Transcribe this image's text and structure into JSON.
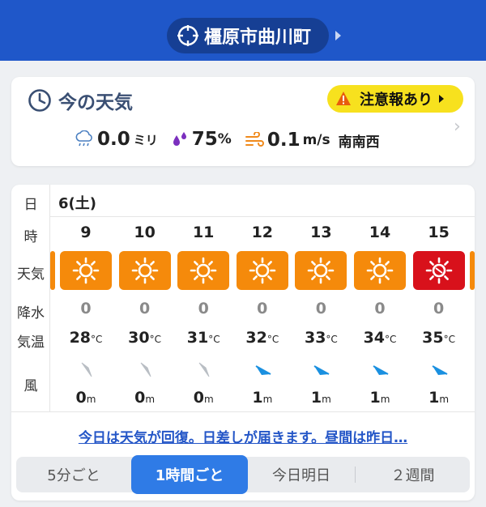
{
  "header": {
    "location": "橿原市曲川町",
    "icon": "location-target-icon"
  },
  "current": {
    "title": "今の天気",
    "warning_label": "注意報あり",
    "precip_value": "0.0",
    "precip_unit": "ミリ",
    "humidity_value": "75",
    "humidity_unit": "%",
    "wind_value": "0.1",
    "wind_unit": "m/s",
    "wind_dir": "南南西"
  },
  "forecast": {
    "labels": {
      "date": "日",
      "hour": "時",
      "weather": "天気",
      "precip": "降水",
      "temp": "気温",
      "wind": "風"
    },
    "date": "6(土)",
    "hours": [
      {
        "hour": "9",
        "weather": "sunny",
        "color": "#f58a0b",
        "precip": "0",
        "temp": "28",
        "wind": "0",
        "wind_color": "#b9bec4",
        "wind_dir": "calm"
      },
      {
        "hour": "10",
        "weather": "sunny",
        "color": "#f58a0b",
        "precip": "0",
        "temp": "30",
        "wind": "0",
        "wind_color": "#b9bec4",
        "wind_dir": "calm"
      },
      {
        "hour": "11",
        "weather": "sunny",
        "color": "#f58a0b",
        "precip": "0",
        "temp": "31",
        "wind": "0",
        "wind_color": "#b9bec4",
        "wind_dir": "calm"
      },
      {
        "hour": "12",
        "weather": "sunny",
        "color": "#f58a0b",
        "precip": "0",
        "temp": "32",
        "wind": "1",
        "wind_color": "#1a90e0",
        "wind_dir": "SW"
      },
      {
        "hour": "13",
        "weather": "sunny",
        "color": "#f58a0b",
        "precip": "0",
        "temp": "33",
        "wind": "1",
        "wind_color": "#1a90e0",
        "wind_dir": "SW"
      },
      {
        "hour": "14",
        "weather": "sunny",
        "color": "#f58a0b",
        "precip": "0",
        "temp": "34",
        "wind": "1",
        "wind_color": "#1a90e0",
        "wind_dir": "SW"
      },
      {
        "hour": "15",
        "weather": "hot-sunny",
        "color": "#d8111b",
        "precip": "0",
        "temp": "35",
        "wind": "1",
        "wind_color": "#1a90e0",
        "wind_dir": "SW"
      }
    ],
    "temp_unit": "°C",
    "wind_unit": "m"
  },
  "summary": "今日は天気が回復。日差しが届きます。昼間は昨日…",
  "tabs": [
    {
      "label": "5分ごと",
      "active": false
    },
    {
      "label": "1時間ごと",
      "active": true
    },
    {
      "label": "今日明日",
      "active": false
    },
    {
      "label": "２週間",
      "active": false
    }
  ],
  "colors": {
    "header_bg": "#1f57c9",
    "warning_bg": "#f7e11e",
    "sunny_box": "#f58a0b",
    "hot_box": "#d8111b",
    "active_tab": "#2f7be6",
    "link": "#2456c7"
  }
}
